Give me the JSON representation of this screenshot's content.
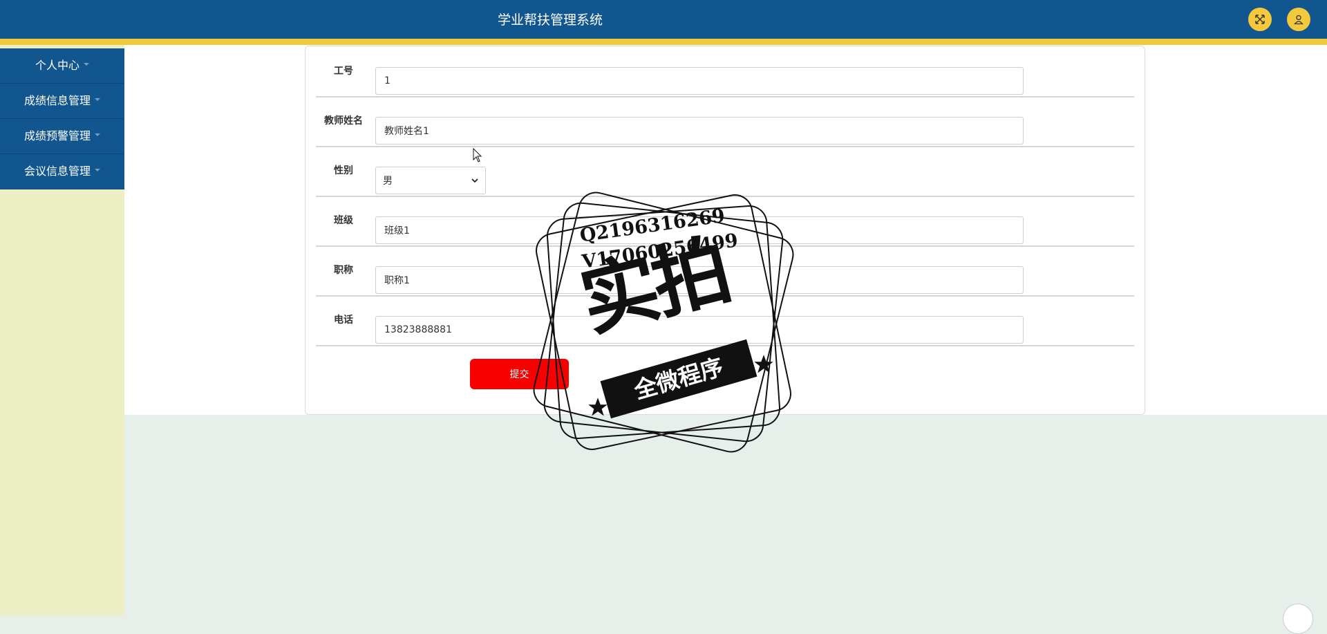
{
  "header": {
    "title": "学业帮扶管理系统",
    "fullscreen_icon": "expand-icon",
    "user_icon": "user-icon",
    "accent_color": "#f4c93c",
    "bg_color": "#125690"
  },
  "sidebar": {
    "items": [
      {
        "label": "个人中心"
      },
      {
        "label": "成绩信息管理"
      },
      {
        "label": "成绩预警管理"
      },
      {
        "label": "会议信息管理"
      }
    ]
  },
  "form": {
    "fields": [
      {
        "label": "工号",
        "value": "1"
      },
      {
        "label": "教师姓名",
        "value": "教师姓名1"
      },
      {
        "label": "性别",
        "value": "男"
      },
      {
        "label": "班级",
        "value": "班级1"
      },
      {
        "label": "职称",
        "value": "职称1"
      },
      {
        "label": "电话",
        "value": "13823888881"
      }
    ],
    "submit_label": "提交",
    "submit_color": "#f70000"
  },
  "watermark": {
    "line1": "Q2196316269",
    "line2": "V17060256499",
    "big_text": "实拍",
    "ribbon_text": "全微程序"
  }
}
